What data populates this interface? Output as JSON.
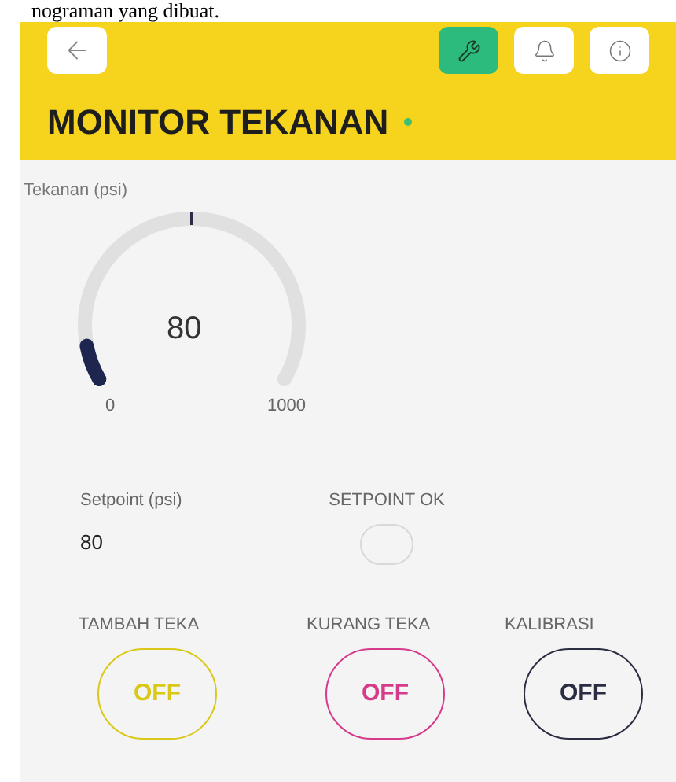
{
  "document_text": "nograman yang dibuat.",
  "header": {
    "title": "MONITOR TEKANAN",
    "online": true,
    "tools_active": true
  },
  "gauge": {
    "label": "Tekanan (psi)",
    "value": "80",
    "min": "0",
    "max": "1000",
    "level": 0.08
  },
  "setpoint": {
    "label": "Setpoint (psi)",
    "value": "80"
  },
  "led": {
    "label": "SETPOINT OK",
    "on": false
  },
  "buttons": [
    {
      "label": "TAMBAH TEKA",
      "state": "OFF",
      "color": "#d9c816"
    },
    {
      "label": "KURANG TEKA",
      "state": "OFF",
      "color": "#d63a8a"
    },
    {
      "label": "KALIBRASI",
      "state": "OFF",
      "color": "#2b2d42"
    }
  ]
}
